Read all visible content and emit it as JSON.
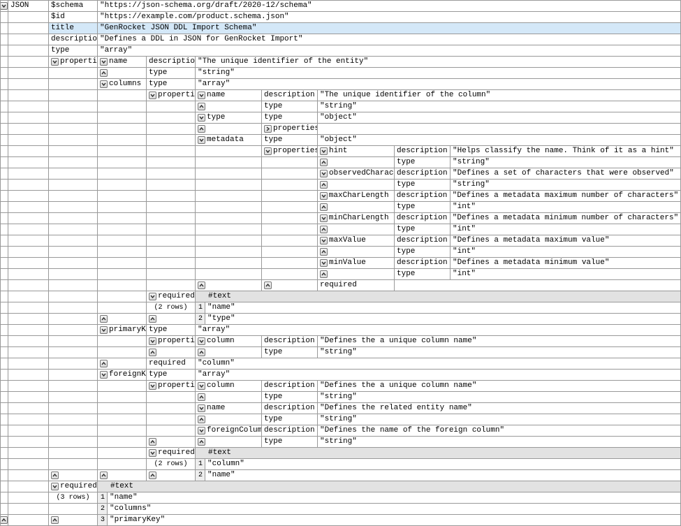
{
  "root_label": "JSON",
  "top": {
    "schema_k": "$schema",
    "schema_v": "\"https://json-schema.org/draft/2020-12/schema\"",
    "id_k": "$id",
    "id_v": "\"https://example.com/product.schema.json\"",
    "title_k": "title",
    "title_v": "\"GenRocket JSON DDL Import Schema\"",
    "desc_k": "description",
    "desc_v": "\"Defines a DDL in JSON for GenRocket Import\"",
    "type_k": "type",
    "type_v": "\"array\"",
    "properties_k": "properties",
    "required_k": "required",
    "required_rows": "(3 rows)",
    "required_hdr": "#text",
    "required_vals": [
      "\"name\"",
      "\"columns\"",
      "\"primaryKey\""
    ]
  },
  "props": {
    "name_k": "name",
    "name_desc_k": "description",
    "name_desc_v": "\"The unique identifier of the entity\"",
    "name_type_k": "type",
    "name_type_v": "\"string\"",
    "columns_k": "columns",
    "columns_type_k": "type",
    "columns_type_v": "\"array\"",
    "columns_props_k": "properties",
    "primaryKey_k": "primaryKey",
    "primaryKey_type_k": "type",
    "primaryKey_type_v": "\"array\"",
    "primaryKey_props_k": "properties",
    "foreignKeys_k": "foreignKeys",
    "foreignKeys_type_k": "type",
    "foreignKeys_type_v": "\"array\"",
    "foreignKeys_props_k": "properties",
    "req_k": "required",
    "req_rows": "(2 rows)",
    "req_hdr": "#text",
    "cols_req_vals": [
      "\"name\"",
      "\"type\""
    ],
    "fk_req_vals": [
      "\"column\"",
      "\"name\""
    ]
  },
  "cols_props": {
    "name_k": "name",
    "name_desc_k": "description",
    "name_desc_v": "\"The unique identifier of the column\"",
    "name_type_k": "type",
    "name_type_v": "\"string\"",
    "type_k": "type",
    "type_type_k": "type",
    "type_type_v": "\"object\"",
    "type_props_k": "properties",
    "metadata_k": "metadata",
    "metadata_type_k": "type",
    "metadata_type_v": "\"object\"",
    "metadata_props_k": "properties",
    "required_k": "required"
  },
  "meta_props": {
    "hint_k": "hint",
    "hint_desc_k": "description",
    "hint_desc_v": "\"Helps classify the name. Think of it as a hint\"",
    "hint_type_k": "type",
    "hint_type_v": "\"string\"",
    "oc_k": "observedCharacters",
    "oc_desc_k": "description",
    "oc_desc_v": "\"Defines a set of characters that were observed\"",
    "oc_type_k": "type",
    "oc_type_v": "\"string\"",
    "maxcl_k": "maxCharLength",
    "maxcl_desc_k": "description",
    "maxcl_desc_v": "\"Defines a metadata maximum number of characters\"",
    "maxcl_type_k": "type",
    "maxcl_type_v": "\"int\"",
    "mincl_k": "minCharLength",
    "mincl_desc_k": "description",
    "mincl_desc_v": "\"Defines a metadata minimum number of characters\"",
    "mincl_type_k": "type",
    "mincl_type_v": "\"int\"",
    "maxv_k": "maxValue",
    "maxv_desc_k": "description",
    "maxv_desc_v": "\"Defines a metadata maximum value\"",
    "maxv_type_k": "type",
    "maxv_type_v": "\"int\"",
    "minv_k": "minValue",
    "minv_desc_k": "description",
    "minv_desc_v": "\"Defines a metadata minimum value\"",
    "minv_type_k": "type",
    "minv_type_v": "\"int\""
  },
  "pk_props": {
    "column_k": "column",
    "column_desc_k": "description",
    "column_desc_v": "\"Defines the a unique column name\"",
    "column_type_k": "type",
    "column_type_v": "\"string\"",
    "required_k": "required",
    "required_v": "\"column\""
  },
  "fk_props": {
    "column_k": "column",
    "column_desc_k": "description",
    "column_desc_v": "\"Defines the a unique column name\"",
    "column_type_k": "type",
    "column_type_v": "\"string\"",
    "name_k": "name",
    "name_desc_k": "description",
    "name_desc_v": "\"Defines the related entity name\"",
    "name_type_k": "type",
    "name_type_v": "\"string\"",
    "fc_k": "foreignColumn",
    "fc_desc_k": "description",
    "fc_desc_v": "\"Defines the name of the foreign column\"",
    "fc_type_k": "type",
    "fc_type_v": "\"string\""
  }
}
